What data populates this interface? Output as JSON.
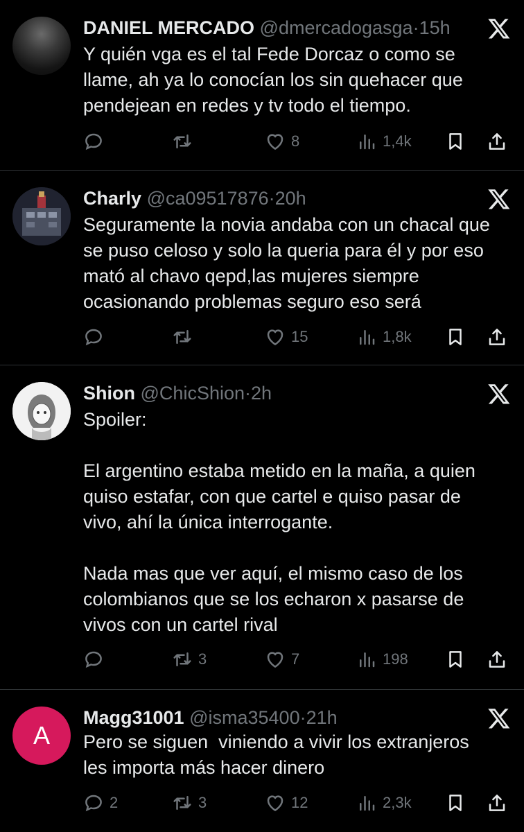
{
  "tweets": [
    {
      "name": "DANIEL MERCADO",
      "handle": "@dmercadogasga",
      "dot": "·",
      "time": "15h",
      "text": "Y quién vga es el tal Fede Dorcaz o como se llame, ah ya lo conocían los sin quehacer que pendejean en redes y tv todo el tiempo.",
      "replies": "",
      "retweets": "",
      "likes": "8",
      "views": "1,4k",
      "avatar_color": "#2a2a2a"
    },
    {
      "name": "Charly",
      "handle": "@ca09517876",
      "dot": "·",
      "time": "20h",
      "text": "Seguramente la novia andaba con un chacal que se puso celoso y solo la queria para él y por eso mató al chavo qepd,las mujeres siempre ocasionando problemas seguro eso será",
      "replies": "",
      "retweets": "",
      "likes": "15",
      "views": "1,8k",
      "avatar_color": "#3b3f4a"
    },
    {
      "name": "Shion",
      "handle": "@ChicShion",
      "dot": "·",
      "time": "2h",
      "text": "Spoiler:\n\nEl argentino estaba metido en la maña, a quien quiso estafar, con que cartel e quiso pasar de vivo, ahí la única interrogante.\n\nNada mas que ver aquí, el mismo caso de los colombianos que se los echaron x pasarse de vivos con un cartel rival",
      "replies": "",
      "retweets": "3",
      "likes": "7",
      "views": "198",
      "avatar_color": "#f2f2f2"
    },
    {
      "name": "Magg31001",
      "handle": "@isma35400",
      "dot": "·",
      "time": "21h",
      "text": "Pero se siguen  viniendo a vivir los extranjeros les importa más hacer dinero",
      "replies": "2",
      "retweets": "3",
      "likes": "12",
      "views": "2,3k",
      "avatar_letter": "A",
      "avatar_color": "#d6195c"
    }
  ],
  "icons": {
    "reply": "reply-icon",
    "retweet": "retweet-icon",
    "like": "heart-icon",
    "views": "views-icon",
    "bookmark": "bookmark-icon",
    "share": "share-icon",
    "logo": "x-logo-icon"
  },
  "colors": {
    "background": "#000000",
    "text": "#e7e9ea",
    "muted": "#71767b",
    "divider": "#2f3336"
  }
}
